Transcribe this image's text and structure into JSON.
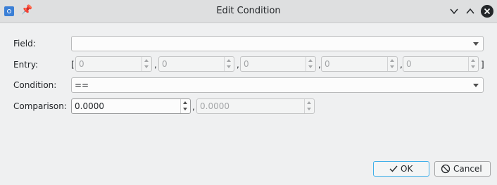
{
  "window": {
    "title": "Edit Condition",
    "icons": {
      "app": "settings-icon",
      "pin": "pin-icon",
      "minimize": "chevron-down-icon",
      "maximize": "chevron-up-icon",
      "close": "close-icon"
    }
  },
  "form": {
    "field": {
      "label": "Field:",
      "value": ""
    },
    "entry": {
      "label": "Entry:",
      "open_bracket": "[",
      "close_bracket": "]",
      "separator": ",",
      "values": [
        "0",
        "0",
        "0",
        "0",
        "0"
      ]
    },
    "condition": {
      "label": "Condition:",
      "value": "=="
    },
    "comparison": {
      "label": "Comparison:",
      "value": "0.0000",
      "separator": ",",
      "value2": "0.0000"
    }
  },
  "buttons": {
    "ok": "OK",
    "cancel": "Cancel"
  },
  "colors": {
    "accent": "#3daee9",
    "window_bg": "#eff0f1",
    "titlebar_bg": "#dedfe0"
  }
}
